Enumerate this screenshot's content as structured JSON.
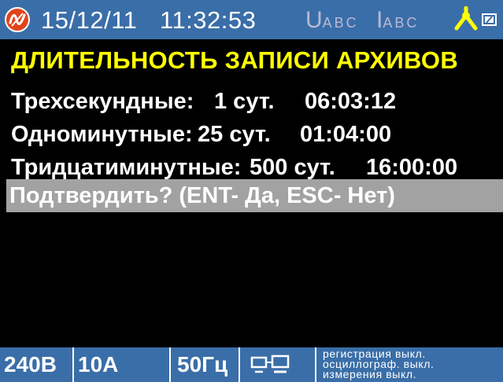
{
  "status_bar": {
    "date": "15/12/11",
    "time": "11:32:53",
    "voltage_indicator": {
      "letter": "U",
      "phases": "ABC"
    },
    "current_indicator": {
      "letter": "I",
      "phases": "ABC"
    },
    "icons": {
      "logo": "device-logo-icon",
      "sync": "tripod-sync-icon",
      "battery": "battery-icon"
    },
    "colors": {
      "bar": "#3a6ea8",
      "logo": "#e0451c",
      "sync_icon": "#ffff00",
      "indicator": "#b9b9d4"
    }
  },
  "main": {
    "title": "ДЛИТЕЛЬНОСТЬ ЗАПИСИ АРХИВОВ",
    "rows": [
      {
        "label": "Трехсекундные:",
        "days": "1 сут.",
        "time": "06:03:12"
      },
      {
        "label": "Одноминутные:",
        "days": "25 сут.",
        "time": "01:04:00"
      },
      {
        "label": "Тридцатиминутные:",
        "days": "500 сут.",
        "time": "16:00:00"
      }
    ],
    "confirm": "Подтвердить? (ENT- Да, ESC- Нет)",
    "colors": {
      "title": "#ffff00",
      "text": "#ffffff",
      "background": "#000000",
      "confirm_highlight": "#a2a2a2"
    }
  },
  "bottom_bar": {
    "voltage": "240В",
    "current": "10А",
    "frequency": "50Гц",
    "pc_icon": "computer-connection-icon",
    "status": [
      "регистрация выкл.",
      "осциллограф. выкл.",
      "измерения выкл."
    ]
  }
}
